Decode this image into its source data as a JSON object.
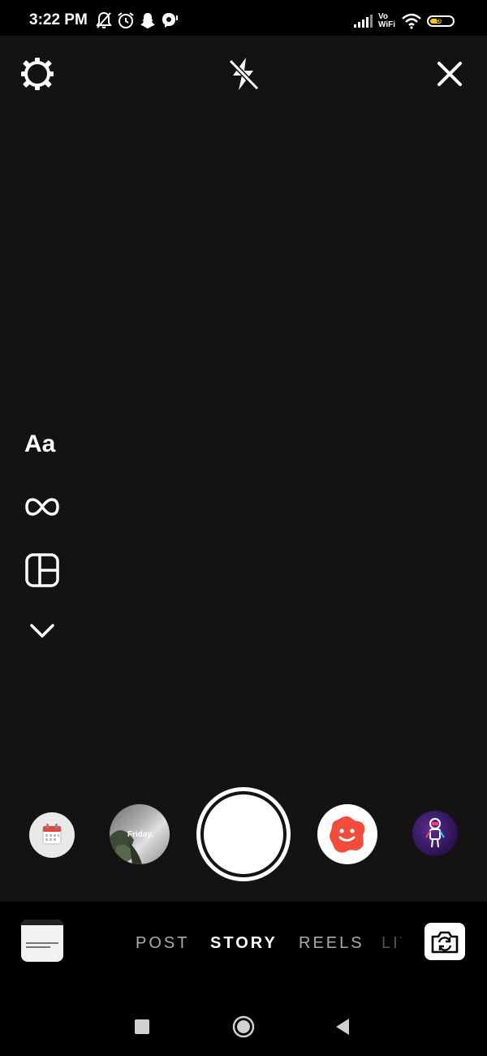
{
  "status_bar": {
    "time": "3:22 PM",
    "left_icons": [
      "bell-off-icon",
      "alarm-icon",
      "snapchat-icon",
      "messenger-icon"
    ],
    "network_label_line1": "Vo",
    "network_label_line2": "WiFi",
    "battery_level": "55",
    "battery_fraction": 0.55,
    "battery_color": "#f5c518"
  },
  "top_controls": {
    "settings_icon": "gear-icon",
    "flash_icon": "flash-off-icon",
    "close_icon": "close-icon"
  },
  "left_toolbar": {
    "text_tool_label": "Aa",
    "items": [
      "text-tool",
      "boomerang-icon",
      "layout-icon",
      "chevron-down-icon"
    ]
  },
  "effects": {
    "items": [
      "calendar-effect",
      "friday-effect",
      "blob-face-effect",
      "astronaut-effect"
    ],
    "friday_label": "Friday."
  },
  "modes": {
    "post": "POST",
    "story": "STORY",
    "reels": "REELS",
    "live": "LIVE",
    "selected": "STORY"
  },
  "colors": {
    "background": "#141212",
    "blob": "#f24d3c",
    "astronaut_bg": "#3a1a6b"
  }
}
